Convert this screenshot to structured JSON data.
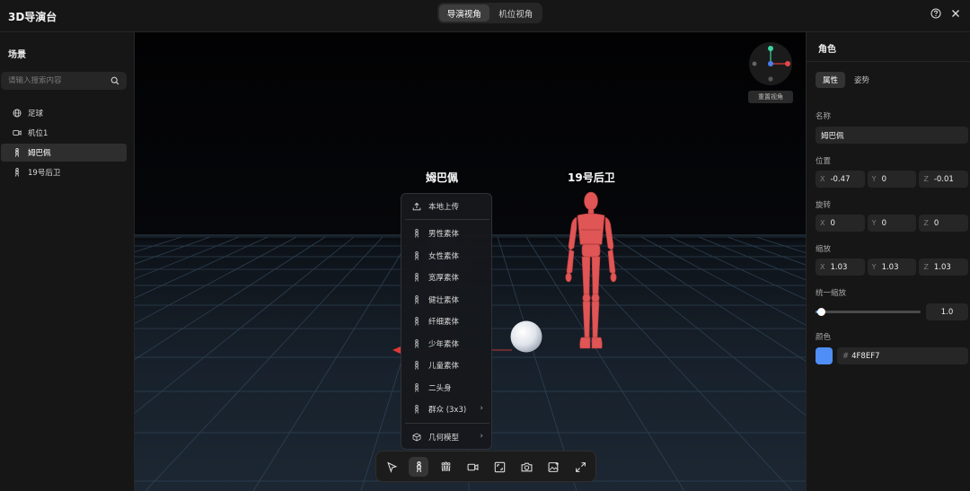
{
  "app": {
    "title": "3D导演台",
    "view_modes": [
      {
        "label": "导演视角",
        "active": true
      },
      {
        "label": "机位视角",
        "active": false
      }
    ]
  },
  "left_panel": {
    "title": "场景",
    "search_placeholder": "请输入搜索内容",
    "items": [
      {
        "icon": "globe-icon",
        "label": "足球",
        "active": false
      },
      {
        "icon": "camera-icon",
        "label": "机位1",
        "active": false
      },
      {
        "icon": "person-icon",
        "label": "姆巴佩",
        "active": true
      },
      {
        "icon": "person-icon",
        "label": "19号后卫",
        "active": false
      }
    ]
  },
  "viewport": {
    "characters": [
      {
        "label": "姆巴佩"
      },
      {
        "label": "19号后卫"
      }
    ],
    "reset_view_label": "重置视角",
    "colors": {
      "mannequin": "#e05555",
      "ball": "#e8ecf2",
      "axis_x": "#e03838",
      "axis_y": "#3bd6a0",
      "axis_z": "#4a7df0"
    }
  },
  "context_menu": {
    "items": [
      {
        "icon": "upload-icon",
        "label": "本地上传",
        "has_submenu": false
      },
      {
        "icon": "person-icon",
        "label": "男性素体",
        "has_submenu": false
      },
      {
        "icon": "person-icon",
        "label": "女性素体",
        "has_submenu": false
      },
      {
        "icon": "person-icon",
        "label": "宽厚素体",
        "has_submenu": false
      },
      {
        "icon": "person-icon",
        "label": "健壮素体",
        "has_submenu": false
      },
      {
        "icon": "person-icon",
        "label": "纤细素体",
        "has_submenu": false
      },
      {
        "icon": "person-icon",
        "label": "少年素体",
        "has_submenu": false
      },
      {
        "icon": "person-icon",
        "label": "儿童素体",
        "has_submenu": false
      },
      {
        "icon": "person-icon",
        "label": "二头身",
        "has_submenu": false
      },
      {
        "icon": "person-icon",
        "label": "群众 (3x3)",
        "has_submenu": true
      },
      {
        "icon": "cube-icon",
        "label": "几何模型",
        "has_submenu": true
      }
    ]
  },
  "toolbar": {
    "tools": [
      {
        "name": "select-tool",
        "icon": "cursor-icon",
        "active": false
      },
      {
        "name": "add-character-tool",
        "icon": "person-icon",
        "active": true
      },
      {
        "name": "add-crowd-tool",
        "icon": "group-icon",
        "active": false
      },
      {
        "name": "add-camera-tool",
        "icon": "video-camera-icon",
        "active": false
      },
      {
        "name": "frame-tool",
        "icon": "frame-icon",
        "active": false
      },
      {
        "name": "screenshot-tool",
        "icon": "photo-camera-icon",
        "active": false
      },
      {
        "name": "add-image-tool",
        "icon": "image-add-icon",
        "active": false
      },
      {
        "name": "fullscreen-tool",
        "icon": "expand-icon",
        "active": false
      }
    ]
  },
  "right_panel": {
    "title": "角色",
    "tabs": [
      {
        "label": "属性",
        "active": true
      },
      {
        "label": "姿势",
        "active": false
      }
    ],
    "name_label": "名称",
    "name_value": "姆巴佩",
    "position_label": "位置",
    "position": {
      "x": "-0.47",
      "y": "0",
      "z": "-0.01"
    },
    "rotation_label": "旋转",
    "rotation": {
      "x": "0",
      "y": "0",
      "z": "0"
    },
    "scale_label": "缩放",
    "scale": {
      "x": "1.03",
      "y": "1.03",
      "z": "1.03"
    },
    "uniform_scale_label": "统一缩放",
    "uniform_scale_value": "1.0",
    "uniform_scale_fraction": 0.05,
    "color_label": "颜色",
    "color_hash": "#",
    "color_value": "4F8EF7",
    "color_hex": "#4F8EF7"
  }
}
